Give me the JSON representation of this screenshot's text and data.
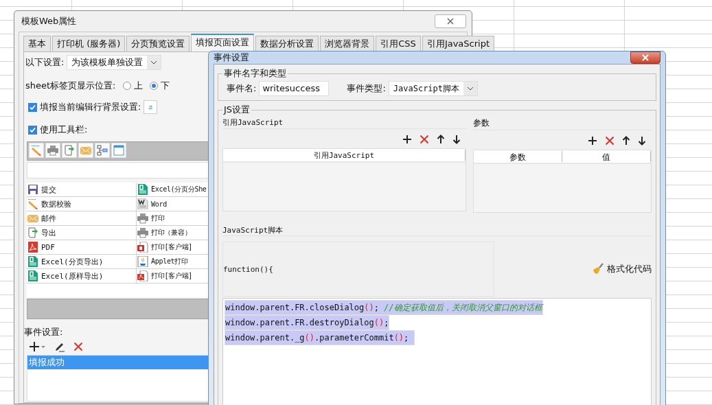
{
  "main_window": {
    "title": "模板Web属性",
    "tabs": [
      {
        "label": "基本",
        "selected": false
      },
      {
        "label": "打印机 (服务器)",
        "selected": false
      },
      {
        "label": "分页预览设置",
        "selected": false
      },
      {
        "label": "填报页面设置",
        "selected": true
      },
      {
        "label": "数据分析设置",
        "selected": false
      },
      {
        "label": "浏览器背景",
        "selected": false
      },
      {
        "label": "引用CSS",
        "selected": false
      },
      {
        "label": "引用JavaScript",
        "selected": false
      }
    ],
    "template_setting": {
      "label": "以下设置:",
      "value": "为该模板单独设置"
    },
    "sheet_tab_position": {
      "label": "sheet标签页显示位置:",
      "options": [
        {
          "label": "上",
          "selected": false
        },
        {
          "label": "下",
          "selected": true
        }
      ]
    },
    "options": [
      {
        "label": "填报当前编辑行背景设置:",
        "checked": true
      },
      {
        "label": "使用工具栏:",
        "checked": true
      }
    ],
    "button_rows": [
      {
        "left": "提交",
        "right": "Excel(分页分She"
      },
      {
        "left": "数据校验",
        "right": "Word"
      },
      {
        "left": "邮件",
        "right": "打印"
      },
      {
        "left": "导出",
        "right": "打印（兼容）"
      },
      {
        "left": "PDF",
        "right": "打印[客户端]"
      },
      {
        "left": "Excel(分页导出)",
        "right": "Applet打印"
      },
      {
        "left": "Excel(原样导出)",
        "right": "打印[客户端]"
      }
    ],
    "events": {
      "label": "事件设置:",
      "items": [
        {
          "label": "填报成功",
          "selected": true
        }
      ]
    }
  },
  "event_dialog": {
    "title": "事件设置",
    "name_group": {
      "legend": "事件名字和类型",
      "name_label": "事件名:",
      "name_value": "writesuccess",
      "type_label": "事件类型:",
      "type_value": "JavaScript脚本"
    },
    "js_group": {
      "legend": "JS设置",
      "references": {
        "heading": "引用JavaScript",
        "columns": [
          "引用JavaScript"
        ]
      },
      "parameters": {
        "heading": "参数",
        "columns": [
          "参数",
          "值"
        ]
      },
      "script": {
        "heading": "JavaScript脚本",
        "header": "function(){",
        "format_button": "格式化代码",
        "lines": [
          {
            "selected": true,
            "tokens": [
              {
                "kind": "code",
                "text": "window.parent.FR.closeDialog"
              },
              {
                "kind": "paren",
                "text": "()"
              },
              {
                "kind": "code",
                "text": "; "
              },
              {
                "kind": "comment",
                "text": "//确定获取值后，关闭取消父窗口的对话框"
              }
            ]
          },
          {
            "selected": true,
            "tokens": [
              {
                "kind": "code",
                "text": "window.parent.FR.destroyDialog"
              },
              {
                "kind": "paren",
                "text": "()"
              },
              {
                "kind": "code",
                "text": ";"
              }
            ]
          },
          {
            "selected": true,
            "tokens": [
              {
                "kind": "code",
                "text": "window.parent._g"
              },
              {
                "kind": "paren",
                "text": "()"
              },
              {
                "kind": "code",
                "text": ".parameterCommit"
              },
              {
                "kind": "paren",
                "text": "()"
              },
              {
                "kind": "code",
                "text": "; "
              }
            ]
          }
        ]
      }
    }
  }
}
